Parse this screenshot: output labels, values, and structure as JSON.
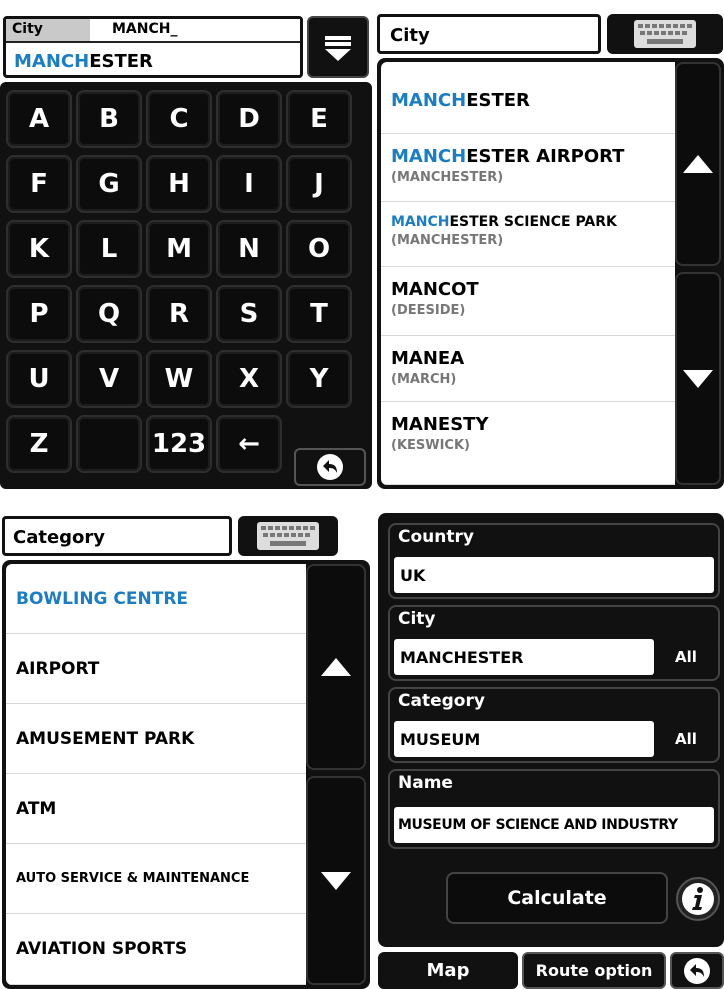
{
  "keyboard_screen": {
    "field_label": "City",
    "typed_text": "MANCH_",
    "suggestion": {
      "match": "MANCH",
      "rest": "ESTER"
    },
    "keys": [
      "A",
      "B",
      "C",
      "D",
      "E",
      "F",
      "G",
      "H",
      "I",
      "J",
      "K",
      "L",
      "M",
      "N",
      "O",
      "P",
      "Q",
      "R",
      "S",
      "T",
      "U",
      "V",
      "W",
      "X",
      "Y",
      "Z",
      "",
      "123",
      "←"
    ]
  },
  "city_list_screen": {
    "field_label": "City",
    "items": [
      {
        "match": "MANCH",
        "rest": "ESTER",
        "sub": ""
      },
      {
        "match": "MANCH",
        "rest": "ESTER AIRPORT",
        "sub": "(MANCHESTER)"
      },
      {
        "match": "MANCH",
        "rest": "ESTER SCIENCE PARK",
        "sub": "(MANCHESTER)"
      },
      {
        "match": "",
        "rest": "MANCOT",
        "sub": "(DEESIDE)"
      },
      {
        "match": "",
        "rest": "MANEA",
        "sub": "(MARCH)"
      },
      {
        "match": "",
        "rest": "MANESTY",
        "sub": "(KESWICK)"
      }
    ]
  },
  "category_list_screen": {
    "field_label": "Category",
    "items": [
      {
        "label": "BOWLING CENTRE",
        "highlighted": true
      },
      {
        "label": "AIRPORT",
        "highlighted": false
      },
      {
        "label": "AMUSEMENT PARK",
        "highlighted": false
      },
      {
        "label": "ATM",
        "highlighted": false
      },
      {
        "label": "AUTO SERVICE & MAINTENANCE",
        "highlighted": false
      },
      {
        "label": "AVIATION SPORTS",
        "highlighted": false
      }
    ]
  },
  "summary_screen": {
    "country": {
      "label": "Country",
      "value": "UK"
    },
    "city": {
      "label": "City",
      "value": "MANCHESTER",
      "all": "All"
    },
    "category": {
      "label": "Category",
      "value": "MUSEUM",
      "all": "All"
    },
    "name": {
      "label": "Name",
      "value": "MUSEUM OF SCIENCE AND INDUSTRY"
    },
    "calculate_label": "Calculate",
    "map_label": "Map",
    "route_label": "Route option"
  },
  "colors": {
    "accent_blue": "#1a7dc6",
    "panel_black": "#111111",
    "sub_grey": "#777777"
  }
}
